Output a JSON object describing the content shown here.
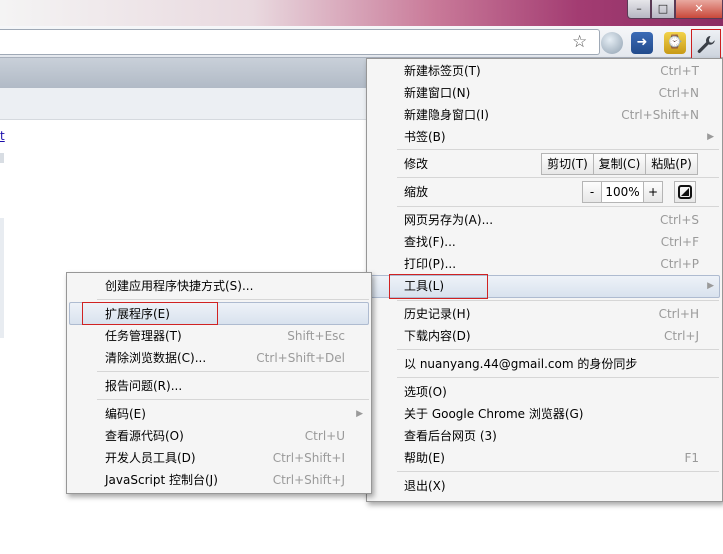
{
  "window": {
    "minimize": "–",
    "maximize": "□",
    "close": "✕"
  },
  "page": {
    "link_text": "t"
  },
  "main_menu": {
    "items": [
      {
        "label": "新建标签页(T)",
        "shortcut": "Ctrl+T"
      },
      {
        "label": "新建窗口(N)",
        "shortcut": "Ctrl+N"
      },
      {
        "label": "新建隐身窗口(I)",
        "shortcut": "Ctrl+Shift+N"
      },
      {
        "label": "书签(B)"
      }
    ],
    "edit": {
      "label": "修改",
      "cut": "剪切(T)",
      "copy": "复制(C)",
      "paste": "粘贴(P)"
    },
    "zoom": {
      "label": "缩放",
      "minus": "-",
      "value": "100%",
      "plus": "+"
    },
    "page_items": [
      {
        "label": "网页另存为(A)...",
        "shortcut": "Ctrl+S"
      },
      {
        "label": "查找(F)...",
        "shortcut": "Ctrl+F"
      },
      {
        "label": "打印(P)...",
        "shortcut": "Ctrl+P"
      },
      {
        "label": "工具(L)"
      }
    ],
    "history_items": [
      {
        "label": "历史记录(H)",
        "shortcut": "Ctrl+H"
      },
      {
        "label": "下载内容(D)",
        "shortcut": "Ctrl+J"
      }
    ],
    "sync": "以 nuanyang.44@gmail.com 的身份同步",
    "about_items": [
      {
        "label": "选项(O)"
      },
      {
        "label": "关于 Google Chrome 浏览器(G)"
      },
      {
        "label": "查看后台网页 (3)"
      },
      {
        "label": "帮助(E)",
        "shortcut": "F1"
      }
    ],
    "exit": "退出(X)"
  },
  "tools_menu": {
    "create_shortcuts": "创建应用程序快捷方式(S)...",
    "items": [
      {
        "label": "扩展程序(E)"
      },
      {
        "label": "任务管理器(T)",
        "shortcut": "Shift+Esc"
      },
      {
        "label": "清除浏览数据(C)...",
        "shortcut": "Ctrl+Shift+Del"
      }
    ],
    "report": "报告问题(R)...",
    "dev_items": [
      {
        "label": "编码(E)"
      },
      {
        "label": "查看源代码(O)",
        "shortcut": "Ctrl+U"
      },
      {
        "label": "开发人员工具(D)",
        "shortcut": "Ctrl+Shift+I"
      },
      {
        "label": "JavaScript 控制台(J)",
        "shortcut": "Ctrl+Shift+J"
      }
    ]
  }
}
